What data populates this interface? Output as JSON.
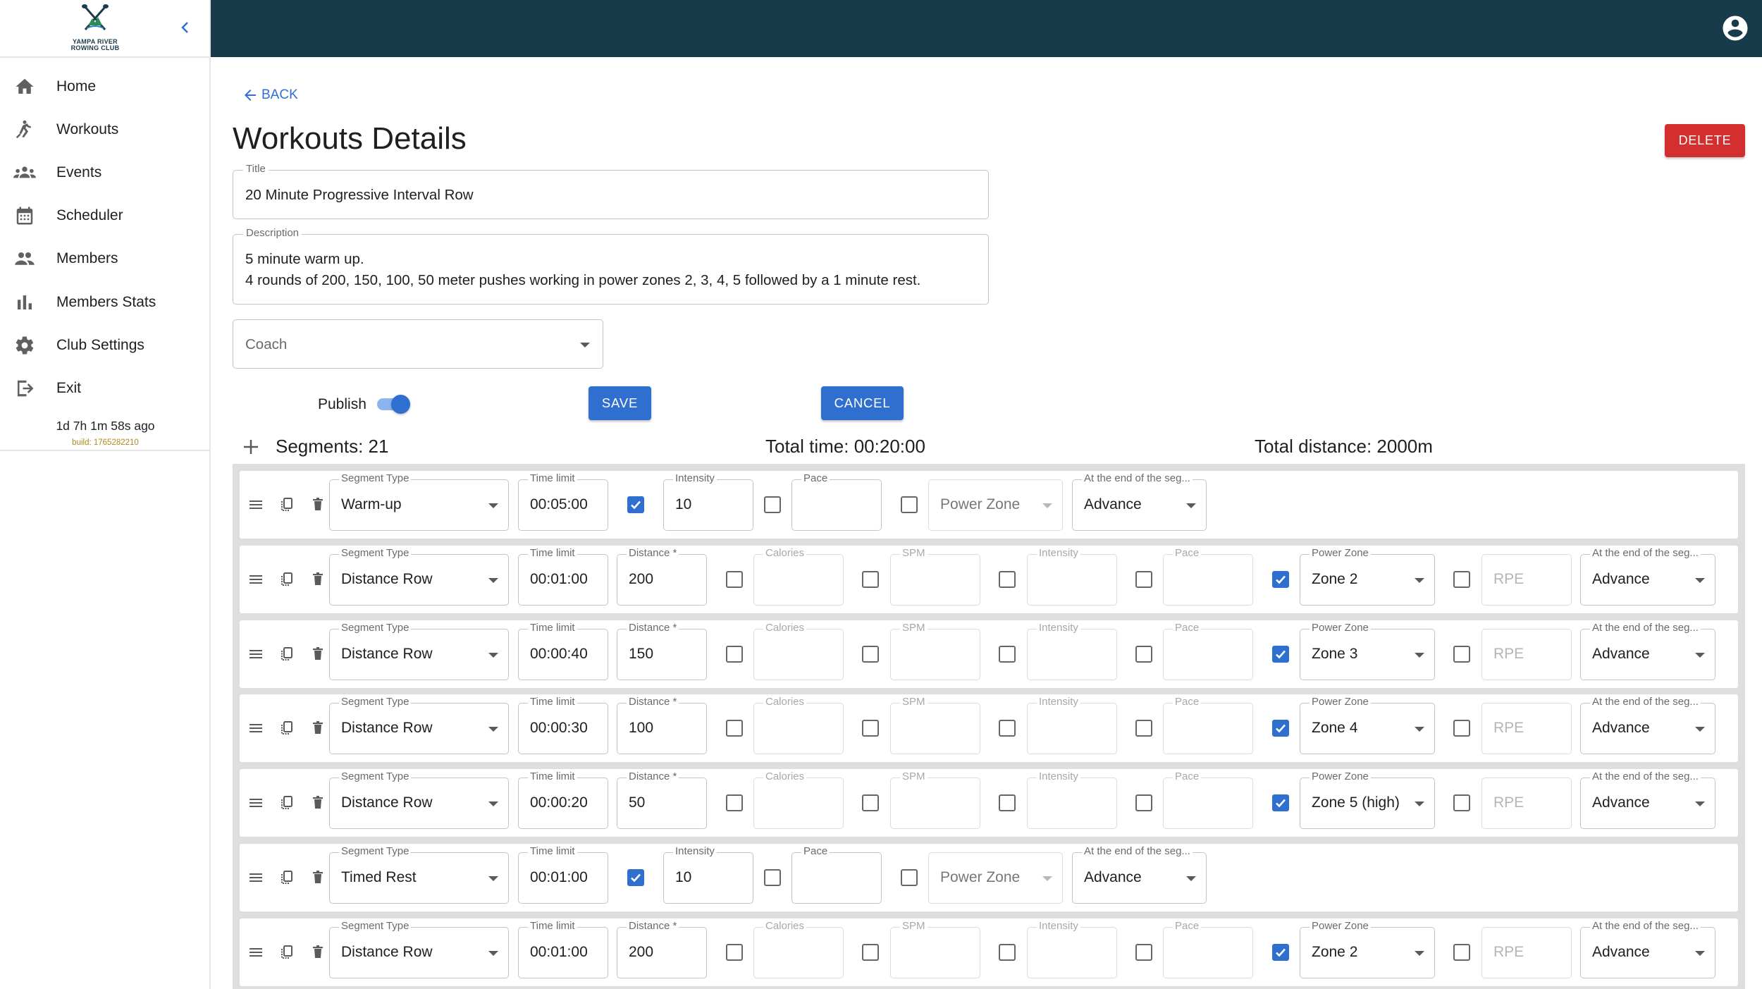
{
  "brand": {
    "logo_text_1": "YAMPA RIVER",
    "logo_text_2": "ROWING CLUB"
  },
  "sidebar": {
    "items": [
      {
        "label": "Home",
        "icon": "home-icon"
      },
      {
        "label": "Workouts",
        "icon": "rowing-icon"
      },
      {
        "label": "Events",
        "icon": "groups-icon"
      },
      {
        "label": "Scheduler",
        "icon": "calendar-icon"
      },
      {
        "label": "Members",
        "icon": "people-icon"
      },
      {
        "label": "Members Stats",
        "icon": "bar-chart-icon"
      },
      {
        "label": "Club Settings",
        "icon": "gear-icon"
      },
      {
        "label": "Exit",
        "icon": "exit-icon"
      }
    ],
    "session": "1d 7h 1m 58s ago",
    "build": "build: 1765282210"
  },
  "page": {
    "back_label": "BACK",
    "title": "Workouts Details",
    "delete_label": "DELETE"
  },
  "form": {
    "title_label": "Title",
    "title_value": "20 Minute Progressive Interval Row",
    "description_label": "Description",
    "description_line1": "5 minute warm up.",
    "description_line2": "4 rounds of 200, 150, 100, 50 meter pushes working in power zones 2, 3, 4, 5 followed by a 1 minute rest.",
    "coach_placeholder": "Coach",
    "publish_label": "Publish",
    "publish_on": true,
    "save_label": "SAVE",
    "cancel_label": "CANCEL"
  },
  "summary": {
    "segments": "Segments: 21",
    "total_time": "Total time: 00:20:00",
    "total_distance": "Total distance: 2000m"
  },
  "segments": [
    {
      "kind": "timed",
      "type": "Warm-up",
      "time": "00:05:00",
      "intensity_checked": true,
      "intensity": "10",
      "pace_checked": false,
      "pace": "",
      "power_checked": false,
      "power": "Power Zone",
      "end": "Advance"
    },
    {
      "kind": "distance",
      "type": "Distance Row",
      "time": "00:01:00",
      "distance": "200",
      "power": "Zone 2",
      "end": "Advance"
    },
    {
      "kind": "distance",
      "type": "Distance Row",
      "time": "00:00:40",
      "distance": "150",
      "power": "Zone 3",
      "end": "Advance"
    },
    {
      "kind": "distance",
      "type": "Distance Row",
      "time": "00:00:30",
      "distance": "100",
      "power": "Zone 4",
      "end": "Advance"
    },
    {
      "kind": "distance",
      "type": "Distance Row",
      "time": "00:00:20",
      "distance": "50",
      "power": "Zone 5 (high)",
      "end": "Advance"
    },
    {
      "kind": "timed",
      "type": "Timed Rest",
      "time": "00:01:00",
      "intensity_checked": true,
      "intensity": "10",
      "pace_checked": false,
      "pace": "",
      "power_checked": false,
      "power": "Power Zone",
      "end": "Advance"
    },
    {
      "kind": "distance",
      "type": "Distance Row",
      "time": "00:01:00",
      "distance": "200",
      "power": "Zone 2",
      "end": "Advance"
    }
  ],
  "segment_labels": {
    "type": "Segment Type",
    "time": "Time limit",
    "distance": "Distance *",
    "calories": "Calories",
    "spm": "SPM",
    "intensity": "Intensity",
    "pace": "Pace",
    "power_zone": "Power Zone",
    "rpe": "RPE",
    "end_short": "At the end of the seg...",
    "end_long": "At the end of the seg..."
  },
  "colors": {
    "topbar": "#183b4b",
    "primary": "#2f6fd0",
    "danger": "#d32f2f"
  }
}
